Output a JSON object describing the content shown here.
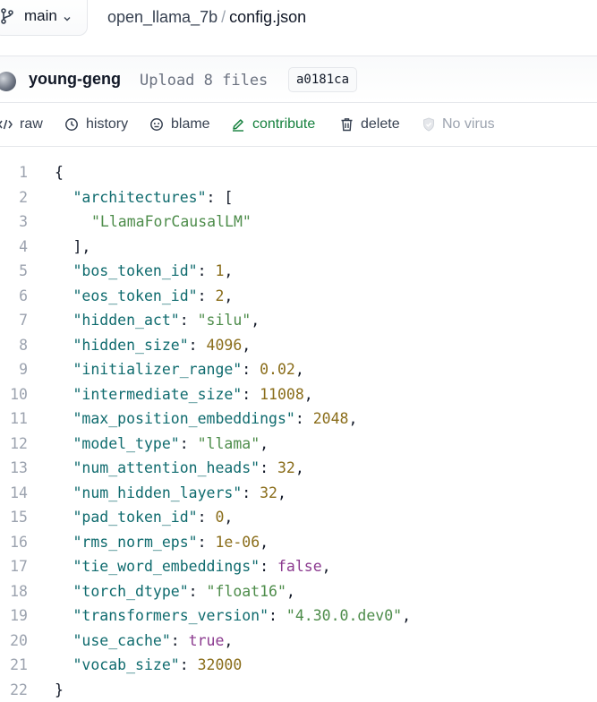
{
  "breadcrumb": {
    "branch": "main",
    "repo": "open_llama_7b",
    "separator": "/",
    "file": "config.json"
  },
  "commit": {
    "author": "young-geng",
    "message": "Upload 8 files",
    "hash": "a0181ca"
  },
  "toolbar": {
    "raw": "raw",
    "history": "history",
    "blame": "blame",
    "contribute": "contribute",
    "delete": "delete",
    "virus": "No virus"
  },
  "colors": {
    "key": "#0f6b6e",
    "string": "#4d8c4a",
    "number": "#8a6d1a",
    "boolean": "#8b3a8f",
    "contribute": "#15803d"
  },
  "code_lines": [
    {
      "n": "1",
      "tokens": [
        {
          "t": "p",
          "v": "{"
        }
      ],
      "indent": 0
    },
    {
      "n": "2",
      "tokens": [
        {
          "t": "k",
          "v": "\"architectures\""
        },
        {
          "t": "p",
          "v": ": ["
        }
      ],
      "indent": 1
    },
    {
      "n": "3",
      "tokens": [
        {
          "t": "s",
          "v": "\"LlamaForCausalLM\""
        }
      ],
      "indent": 2
    },
    {
      "n": "4",
      "tokens": [
        {
          "t": "p",
          "v": "],"
        }
      ],
      "indent": 1
    },
    {
      "n": "5",
      "tokens": [
        {
          "t": "k",
          "v": "\"bos_token_id\""
        },
        {
          "t": "p",
          "v": ": "
        },
        {
          "t": "n",
          "v": "1"
        },
        {
          "t": "p",
          "v": ","
        }
      ],
      "indent": 1
    },
    {
      "n": "6",
      "tokens": [
        {
          "t": "k",
          "v": "\"eos_token_id\""
        },
        {
          "t": "p",
          "v": ": "
        },
        {
          "t": "n",
          "v": "2"
        },
        {
          "t": "p",
          "v": ","
        }
      ],
      "indent": 1
    },
    {
      "n": "7",
      "tokens": [
        {
          "t": "k",
          "v": "\"hidden_act\""
        },
        {
          "t": "p",
          "v": ": "
        },
        {
          "t": "s",
          "v": "\"silu\""
        },
        {
          "t": "p",
          "v": ","
        }
      ],
      "indent": 1
    },
    {
      "n": "8",
      "tokens": [
        {
          "t": "k",
          "v": "\"hidden_size\""
        },
        {
          "t": "p",
          "v": ": "
        },
        {
          "t": "n",
          "v": "4096"
        },
        {
          "t": "p",
          "v": ","
        }
      ],
      "indent": 1
    },
    {
      "n": "9",
      "tokens": [
        {
          "t": "k",
          "v": "\"initializer_range\""
        },
        {
          "t": "p",
          "v": ": "
        },
        {
          "t": "n",
          "v": "0.02"
        },
        {
          "t": "p",
          "v": ","
        }
      ],
      "indent": 1
    },
    {
      "n": "10",
      "tokens": [
        {
          "t": "k",
          "v": "\"intermediate_size\""
        },
        {
          "t": "p",
          "v": ": "
        },
        {
          "t": "n",
          "v": "11008"
        },
        {
          "t": "p",
          "v": ","
        }
      ],
      "indent": 1
    },
    {
      "n": "11",
      "tokens": [
        {
          "t": "k",
          "v": "\"max_position_embeddings\""
        },
        {
          "t": "p",
          "v": ": "
        },
        {
          "t": "n",
          "v": "2048"
        },
        {
          "t": "p",
          "v": ","
        }
      ],
      "indent": 1
    },
    {
      "n": "12",
      "tokens": [
        {
          "t": "k",
          "v": "\"model_type\""
        },
        {
          "t": "p",
          "v": ": "
        },
        {
          "t": "s",
          "v": "\"llama\""
        },
        {
          "t": "p",
          "v": ","
        }
      ],
      "indent": 1
    },
    {
      "n": "13",
      "tokens": [
        {
          "t": "k",
          "v": "\"num_attention_heads\""
        },
        {
          "t": "p",
          "v": ": "
        },
        {
          "t": "n",
          "v": "32"
        },
        {
          "t": "p",
          "v": ","
        }
      ],
      "indent": 1
    },
    {
      "n": "14",
      "tokens": [
        {
          "t": "k",
          "v": "\"num_hidden_layers\""
        },
        {
          "t": "p",
          "v": ": "
        },
        {
          "t": "n",
          "v": "32"
        },
        {
          "t": "p",
          "v": ","
        }
      ],
      "indent": 1
    },
    {
      "n": "15",
      "tokens": [
        {
          "t": "k",
          "v": "\"pad_token_id\""
        },
        {
          "t": "p",
          "v": ": "
        },
        {
          "t": "n",
          "v": "0"
        },
        {
          "t": "p",
          "v": ","
        }
      ],
      "indent": 1
    },
    {
      "n": "16",
      "tokens": [
        {
          "t": "k",
          "v": "\"rms_norm_eps\""
        },
        {
          "t": "p",
          "v": ": "
        },
        {
          "t": "n",
          "v": "1e-06"
        },
        {
          "t": "p",
          "v": ","
        }
      ],
      "indent": 1
    },
    {
      "n": "17",
      "tokens": [
        {
          "t": "k",
          "v": "\"tie_word_embeddings\""
        },
        {
          "t": "p",
          "v": ": "
        },
        {
          "t": "b",
          "v": "false"
        },
        {
          "t": "p",
          "v": ","
        }
      ],
      "indent": 1
    },
    {
      "n": "18",
      "tokens": [
        {
          "t": "k",
          "v": "\"torch_dtype\""
        },
        {
          "t": "p",
          "v": ": "
        },
        {
          "t": "s",
          "v": "\"float16\""
        },
        {
          "t": "p",
          "v": ","
        }
      ],
      "indent": 1
    },
    {
      "n": "19",
      "tokens": [
        {
          "t": "k",
          "v": "\"transformers_version\""
        },
        {
          "t": "p",
          "v": ": "
        },
        {
          "t": "s",
          "v": "\"4.30.0.dev0\""
        },
        {
          "t": "p",
          "v": ","
        }
      ],
      "indent": 1
    },
    {
      "n": "20",
      "tokens": [
        {
          "t": "k",
          "v": "\"use_cache\""
        },
        {
          "t": "p",
          "v": ": "
        },
        {
          "t": "b",
          "v": "true"
        },
        {
          "t": "p",
          "v": ","
        }
      ],
      "indent": 1
    },
    {
      "n": "21",
      "tokens": [
        {
          "t": "k",
          "v": "\"vocab_size\""
        },
        {
          "t": "p",
          "v": ": "
        },
        {
          "t": "n",
          "v": "32000"
        }
      ],
      "indent": 1
    },
    {
      "n": "22",
      "tokens": [
        {
          "t": "p",
          "v": "}"
        }
      ],
      "indent": 0
    }
  ]
}
